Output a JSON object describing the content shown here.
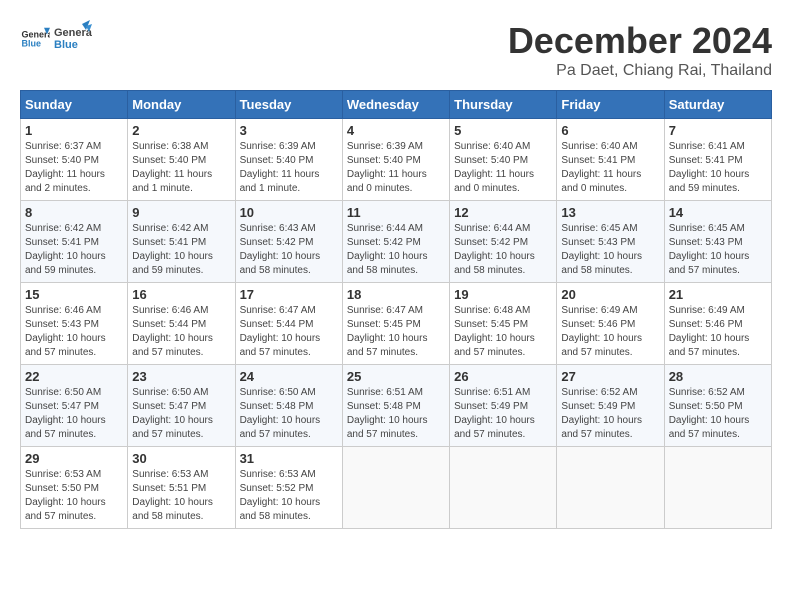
{
  "header": {
    "logo_general": "General",
    "logo_blue": "Blue",
    "month": "December 2024",
    "location": "Pa Daet, Chiang Rai, Thailand"
  },
  "weekdays": [
    "Sunday",
    "Monday",
    "Tuesday",
    "Wednesday",
    "Thursday",
    "Friday",
    "Saturday"
  ],
  "weeks": [
    [
      {
        "day": "1",
        "sunrise": "6:37 AM",
        "sunset": "5:40 PM",
        "daylight": "11 hours and 2 minutes."
      },
      {
        "day": "2",
        "sunrise": "6:38 AM",
        "sunset": "5:40 PM",
        "daylight": "11 hours and 1 minute."
      },
      {
        "day": "3",
        "sunrise": "6:39 AM",
        "sunset": "5:40 PM",
        "daylight": "11 hours and 1 minute."
      },
      {
        "day": "4",
        "sunrise": "6:39 AM",
        "sunset": "5:40 PM",
        "daylight": "11 hours and 0 minutes."
      },
      {
        "day": "5",
        "sunrise": "6:40 AM",
        "sunset": "5:40 PM",
        "daylight": "11 hours and 0 minutes."
      },
      {
        "day": "6",
        "sunrise": "6:40 AM",
        "sunset": "5:41 PM",
        "daylight": "11 hours and 0 minutes."
      },
      {
        "day": "7",
        "sunrise": "6:41 AM",
        "sunset": "5:41 PM",
        "daylight": "10 hours and 59 minutes."
      }
    ],
    [
      {
        "day": "8",
        "sunrise": "6:42 AM",
        "sunset": "5:41 PM",
        "daylight": "10 hours and 59 minutes."
      },
      {
        "day": "9",
        "sunrise": "6:42 AM",
        "sunset": "5:41 PM",
        "daylight": "10 hours and 59 minutes."
      },
      {
        "day": "10",
        "sunrise": "6:43 AM",
        "sunset": "5:42 PM",
        "daylight": "10 hours and 58 minutes."
      },
      {
        "day": "11",
        "sunrise": "6:44 AM",
        "sunset": "5:42 PM",
        "daylight": "10 hours and 58 minutes."
      },
      {
        "day": "12",
        "sunrise": "6:44 AM",
        "sunset": "5:42 PM",
        "daylight": "10 hours and 58 minutes."
      },
      {
        "day": "13",
        "sunrise": "6:45 AM",
        "sunset": "5:43 PM",
        "daylight": "10 hours and 58 minutes."
      },
      {
        "day": "14",
        "sunrise": "6:45 AM",
        "sunset": "5:43 PM",
        "daylight": "10 hours and 57 minutes."
      }
    ],
    [
      {
        "day": "15",
        "sunrise": "6:46 AM",
        "sunset": "5:43 PM",
        "daylight": "10 hours and 57 minutes."
      },
      {
        "day": "16",
        "sunrise": "6:46 AM",
        "sunset": "5:44 PM",
        "daylight": "10 hours and 57 minutes."
      },
      {
        "day": "17",
        "sunrise": "6:47 AM",
        "sunset": "5:44 PM",
        "daylight": "10 hours and 57 minutes."
      },
      {
        "day": "18",
        "sunrise": "6:47 AM",
        "sunset": "5:45 PM",
        "daylight": "10 hours and 57 minutes."
      },
      {
        "day": "19",
        "sunrise": "6:48 AM",
        "sunset": "5:45 PM",
        "daylight": "10 hours and 57 minutes."
      },
      {
        "day": "20",
        "sunrise": "6:49 AM",
        "sunset": "5:46 PM",
        "daylight": "10 hours and 57 minutes."
      },
      {
        "day": "21",
        "sunrise": "6:49 AM",
        "sunset": "5:46 PM",
        "daylight": "10 hours and 57 minutes."
      }
    ],
    [
      {
        "day": "22",
        "sunrise": "6:50 AM",
        "sunset": "5:47 PM",
        "daylight": "10 hours and 57 minutes."
      },
      {
        "day": "23",
        "sunrise": "6:50 AM",
        "sunset": "5:47 PM",
        "daylight": "10 hours and 57 minutes."
      },
      {
        "day": "24",
        "sunrise": "6:50 AM",
        "sunset": "5:48 PM",
        "daylight": "10 hours and 57 minutes."
      },
      {
        "day": "25",
        "sunrise": "6:51 AM",
        "sunset": "5:48 PM",
        "daylight": "10 hours and 57 minutes."
      },
      {
        "day": "26",
        "sunrise": "6:51 AM",
        "sunset": "5:49 PM",
        "daylight": "10 hours and 57 minutes."
      },
      {
        "day": "27",
        "sunrise": "6:52 AM",
        "sunset": "5:49 PM",
        "daylight": "10 hours and 57 minutes."
      },
      {
        "day": "28",
        "sunrise": "6:52 AM",
        "sunset": "5:50 PM",
        "daylight": "10 hours and 57 minutes."
      }
    ],
    [
      {
        "day": "29",
        "sunrise": "6:53 AM",
        "sunset": "5:50 PM",
        "daylight": "10 hours and 57 minutes."
      },
      {
        "day": "30",
        "sunrise": "6:53 AM",
        "sunset": "5:51 PM",
        "daylight": "10 hours and 58 minutes."
      },
      {
        "day": "31",
        "sunrise": "6:53 AM",
        "sunset": "5:52 PM",
        "daylight": "10 hours and 58 minutes."
      },
      null,
      null,
      null,
      null
    ]
  ]
}
